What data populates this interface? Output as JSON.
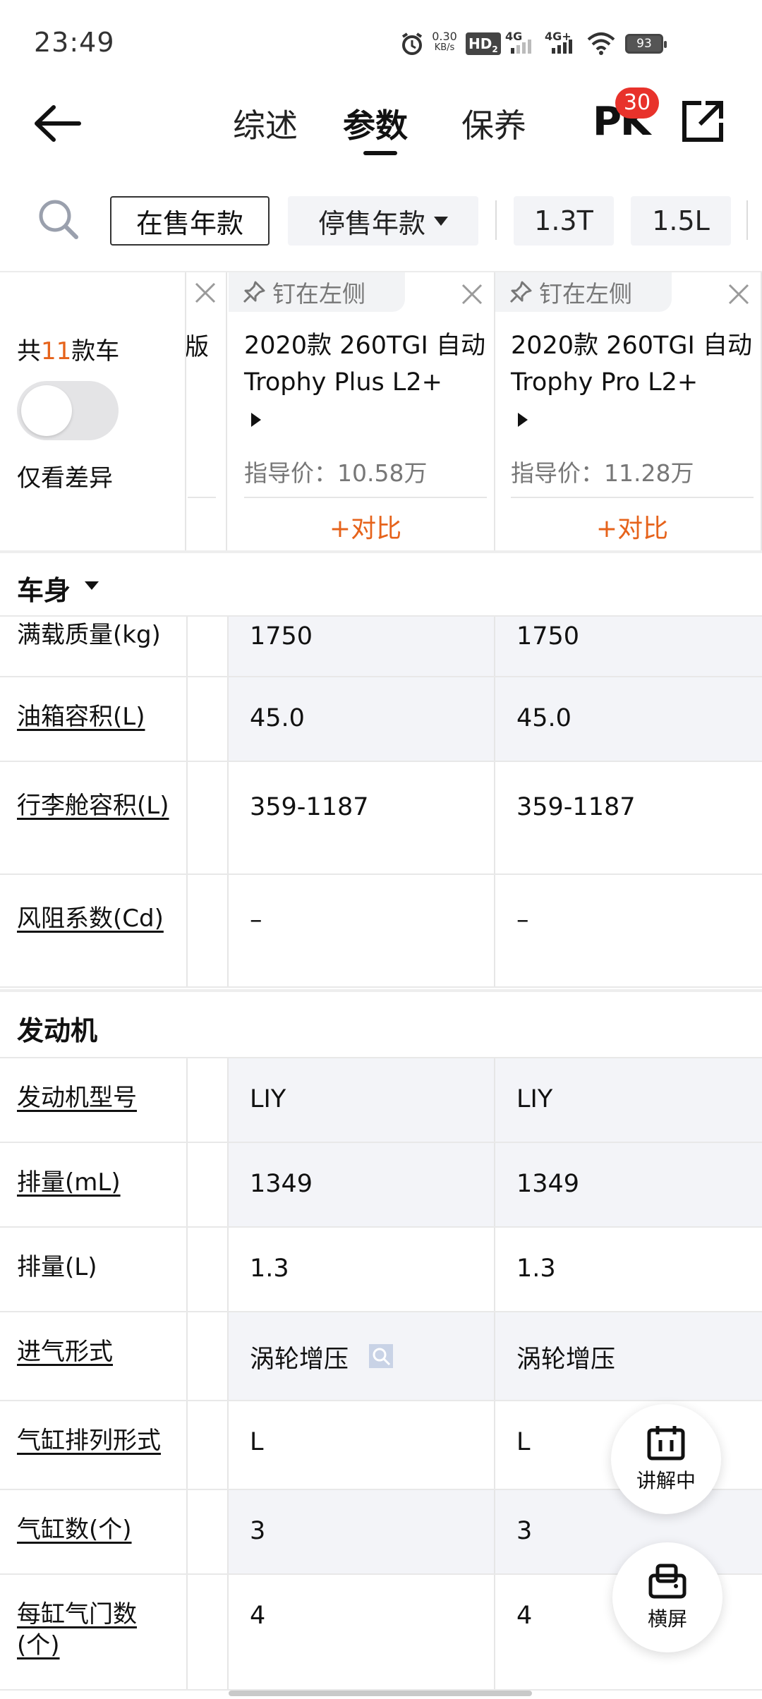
{
  "status_bar": {
    "time": "23:49",
    "net_speed_value": "0.30",
    "net_speed_unit": "KB/s",
    "hd": "HD",
    "hd_sub": "2",
    "sig1": "4G",
    "sig2": "4G+",
    "battery": "93"
  },
  "header": {
    "tabs": [
      {
        "label": "综述",
        "active": false
      },
      {
        "label": "参数",
        "active": true
      },
      {
        "label": "保养",
        "active": false
      }
    ],
    "pk_label": "PK",
    "pk_badge": "30"
  },
  "filters": {
    "chips": [
      "在售年款",
      "停售年款",
      "1.3T",
      "1.5L"
    ]
  },
  "summary": {
    "count_prefix": "共",
    "count_num": "11",
    "count_suffix": "款车",
    "diff_label": "仅看差异",
    "toggle_on": false
  },
  "partial_car_text": "版",
  "cars": [
    {
      "pin_label": "钉在左侧",
      "name": "2020款 260TGI 自动Trophy Plus L2+",
      "price": "指导价：10.58万",
      "compare_label": "+对比"
    },
    {
      "pin_label": "钉在左侧",
      "name": "2020款 260TGI 自动Trophy Pro L2+",
      "price": "指导价：11.28万",
      "compare_label": "+对比"
    }
  ],
  "sections": {
    "body": {
      "title": "车身"
    },
    "engine": {
      "title": "发动机"
    }
  },
  "body_rows": [
    {
      "label": "满载质量(kg)",
      "link": false,
      "v1": "1750",
      "v2": "1750"
    },
    {
      "label": "油箱容积(L)",
      "link": true,
      "v1": "45.0",
      "v2": "45.0"
    },
    {
      "label": "行李舱容积(L)",
      "link": true,
      "v1": "359-1187",
      "v2": "359-1187"
    },
    {
      "label": "风阻系数(Cd)",
      "link": true,
      "v1": "–",
      "v2": "–"
    }
  ],
  "engine_rows": [
    {
      "label": "发动机型号",
      "link": true,
      "v1": "LIY",
      "v2": "LIY"
    },
    {
      "label": "排量(mL)",
      "link": true,
      "v1": "1349",
      "v2": "1349"
    },
    {
      "label": "排量(L)",
      "link": false,
      "v1": "1.3",
      "v2": "1.3"
    },
    {
      "label": "进气形式",
      "link": true,
      "v1": "涡轮增压",
      "v2": "涡轮增压"
    },
    {
      "label": "气缸排列形式",
      "link": true,
      "v1": "L",
      "v2": "L"
    },
    {
      "label": "气缸数(个)",
      "link": true,
      "v1": "3",
      "v2": "3"
    },
    {
      "label": "每缸气门数(个)",
      "link": true,
      "v1": "4",
      "v2": "4"
    }
  ],
  "fabs": {
    "explain": "讲解中",
    "landscape": "横屏"
  },
  "colors": {
    "accent": "#e6631b",
    "badge": "#e8322b",
    "row_shade": "#f3f4f8"
  }
}
